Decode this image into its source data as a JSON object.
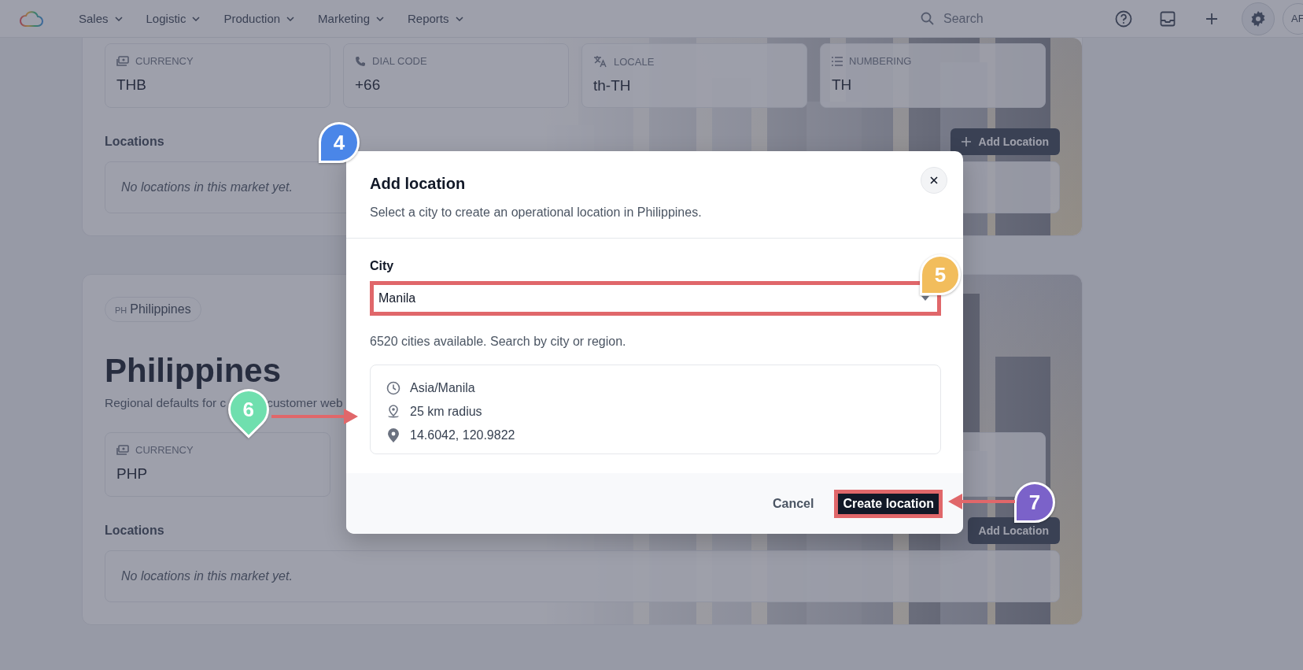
{
  "nav": {
    "menus": [
      {
        "label": "Sales"
      },
      {
        "label": "Logistic"
      },
      {
        "label": "Production"
      },
      {
        "label": "Marketing"
      },
      {
        "label": "Reports"
      }
    ],
    "search": {
      "placeholder": "Search"
    },
    "avatar": "AF"
  },
  "markets": [
    {
      "fields": [
        {
          "kind": "currency",
          "label": "CURRENCY",
          "value": "THB"
        },
        {
          "kind": "phone",
          "label": "DIAL CODE",
          "value": "+66"
        },
        {
          "kind": "locale",
          "label": "LOCALE",
          "value": "th-TH"
        },
        {
          "kind": "numbering",
          "label": "NUMBERING",
          "value": "TH"
        }
      ],
      "locations_label": "Locations",
      "add_button": "Add Location",
      "plus_icon": true,
      "empty": "No locations in this market yet."
    },
    {
      "badge_code": "PH",
      "badge": "Philippines",
      "title": "Philippines",
      "subtitle": [
        "Regional defaults for c",
        "customer web"
      ],
      "fields": [
        {
          "kind": "currency",
          "label": "CURRENCY",
          "value": "PHP"
        }
      ],
      "locations_label": "Locations",
      "add_button": "Add Location",
      "plus_icon": false,
      "empty": "No locations in this market yet."
    }
  ],
  "dialog": {
    "title": "Add location",
    "subtitle": "Select a city to create an operational location in Philippines.",
    "city_label": "City",
    "city_value": "Manila",
    "help": "6520 cities available. Search by city or region.",
    "details": [
      {
        "kind": "timezone",
        "text": "Asia/Manila"
      },
      {
        "kind": "radius",
        "text": "25 km radius"
      },
      {
        "kind": "coordinates",
        "text": "14.6042, 120.9822"
      }
    ],
    "cancel": "Cancel",
    "submit": "Create location"
  },
  "annotations": [
    {
      "number": "4",
      "color": "#4a86e8"
    },
    {
      "number": "5",
      "color": "#f2bd5c"
    },
    {
      "number": "6",
      "color": "#6fdfae",
      "arrow": true
    },
    {
      "number": "7",
      "color": "#7b62c9",
      "arrow": true
    }
  ]
}
